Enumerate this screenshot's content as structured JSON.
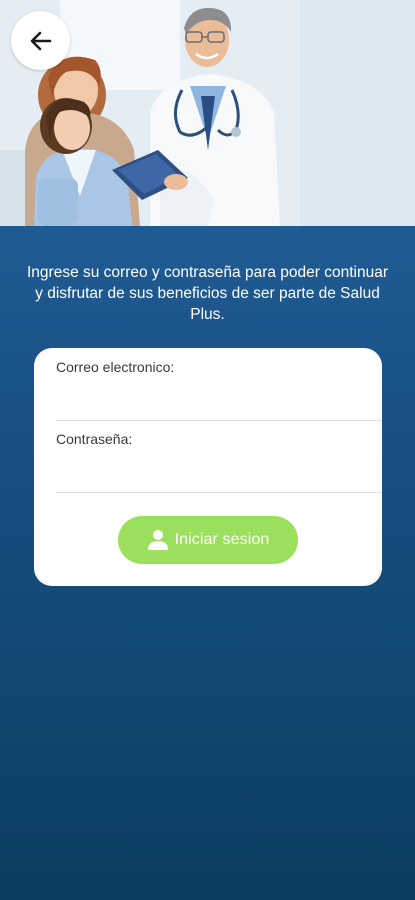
{
  "header": {
    "back_icon": "arrow-left-icon",
    "hero_image": "doctor-with-mother-and-child-photo"
  },
  "intro": {
    "text": "Ingrese su correo y contraseña para poder continuar y disfrutar de sus beneficios de ser parte de Salud Plus."
  },
  "form": {
    "email_label": "Correo electronico:",
    "email_value": "",
    "password_label": "Contraseña:",
    "password_value": "",
    "login_label": "Iniciar sesion",
    "login_icon": "user-icon"
  },
  "colors": {
    "background_top": "#1f5b93",
    "background_bottom": "#0b3d5f",
    "card": "#ffffff",
    "button": "#9be05c"
  }
}
